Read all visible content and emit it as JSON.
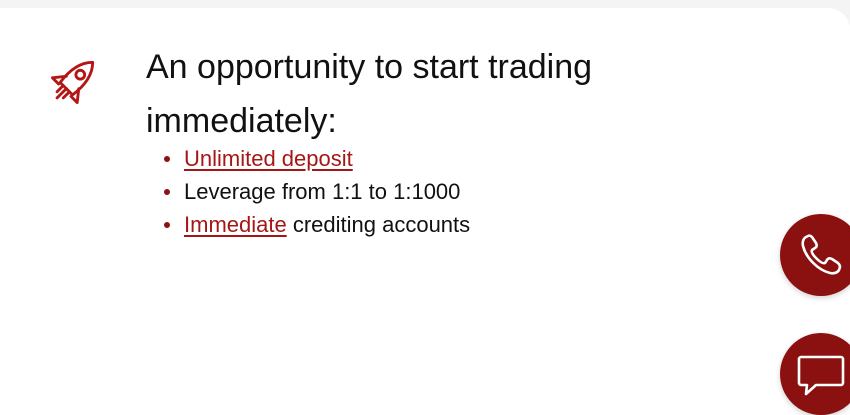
{
  "promo": {
    "icon": "rocket-icon",
    "title": "An opportunity to start trading immediately:",
    "features": [
      {
        "link_text": "Unlimited deposit",
        "text": ""
      },
      {
        "link_text": "",
        "text": "Leverage from 1:1 to 1:1000"
      },
      {
        "link_text": "Immediate",
        "text": " crediting accounts"
      }
    ]
  },
  "floating_buttons": {
    "call_icon": "phone-icon",
    "chat_icon": "chat-bubble-icon"
  },
  "colors": {
    "accent": "#8b1010",
    "link": "#a51717",
    "text": "#111111",
    "background": "#ffffff"
  }
}
